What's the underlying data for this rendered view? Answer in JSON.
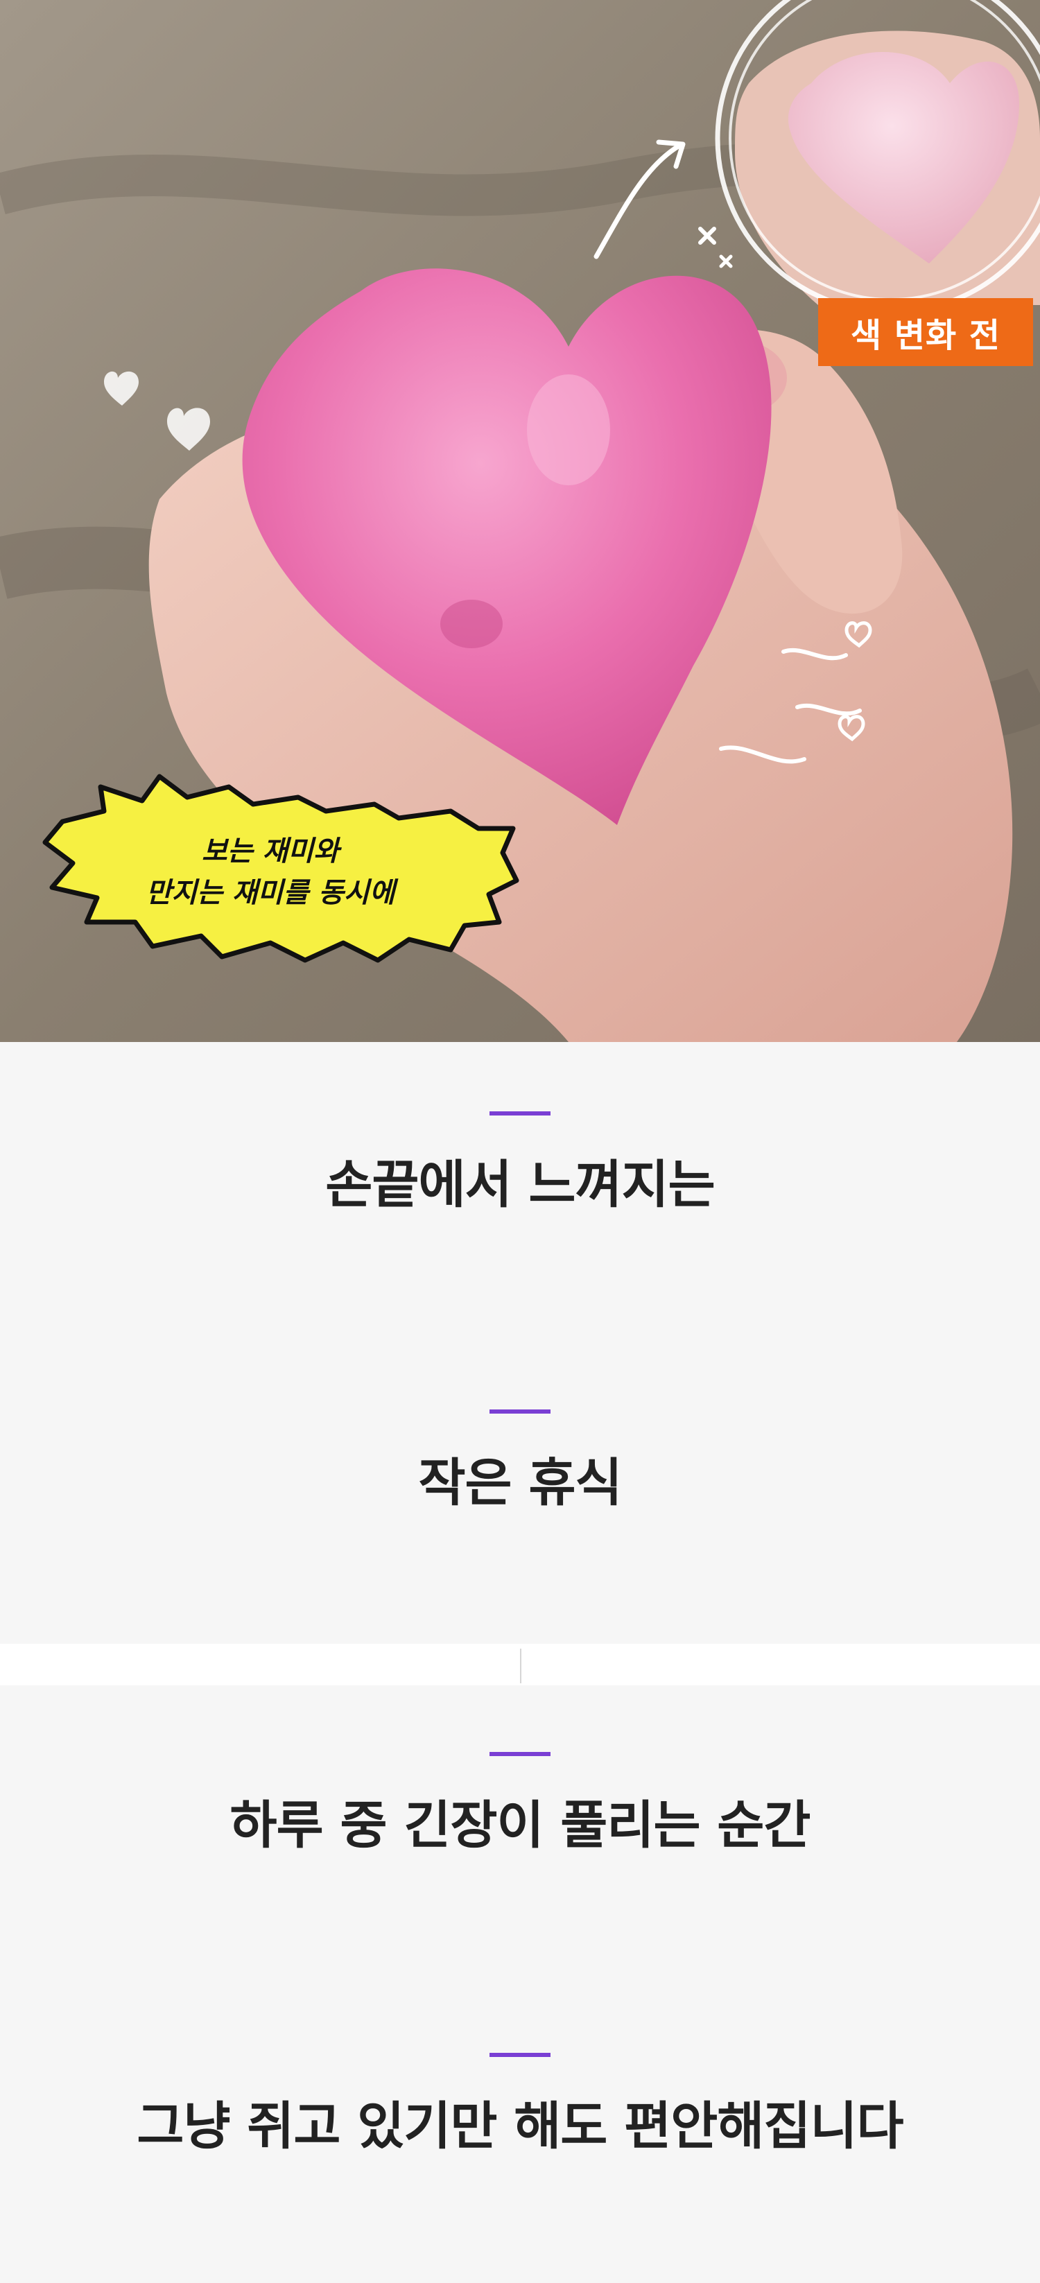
{
  "hero": {
    "badge_text": "색 변화 전",
    "burst_line1": "보는 재미와",
    "burst_line2": "만지는 재미를 동시에"
  },
  "section1": {
    "heading1": "손끝에서 느껴지는",
    "heading2": "작은 휴식"
  },
  "section2": {
    "heading1": "하루 중 긴장이 풀리는 순간",
    "heading2": "그냥 쥐고 있기만 해도 편안해집니다"
  },
  "colors": {
    "accent_bar": "#7a3fd4",
    "badge_bg": "#ee6a17",
    "burst_fill": "#f6f042",
    "section_bg": "#f6f6f6"
  }
}
